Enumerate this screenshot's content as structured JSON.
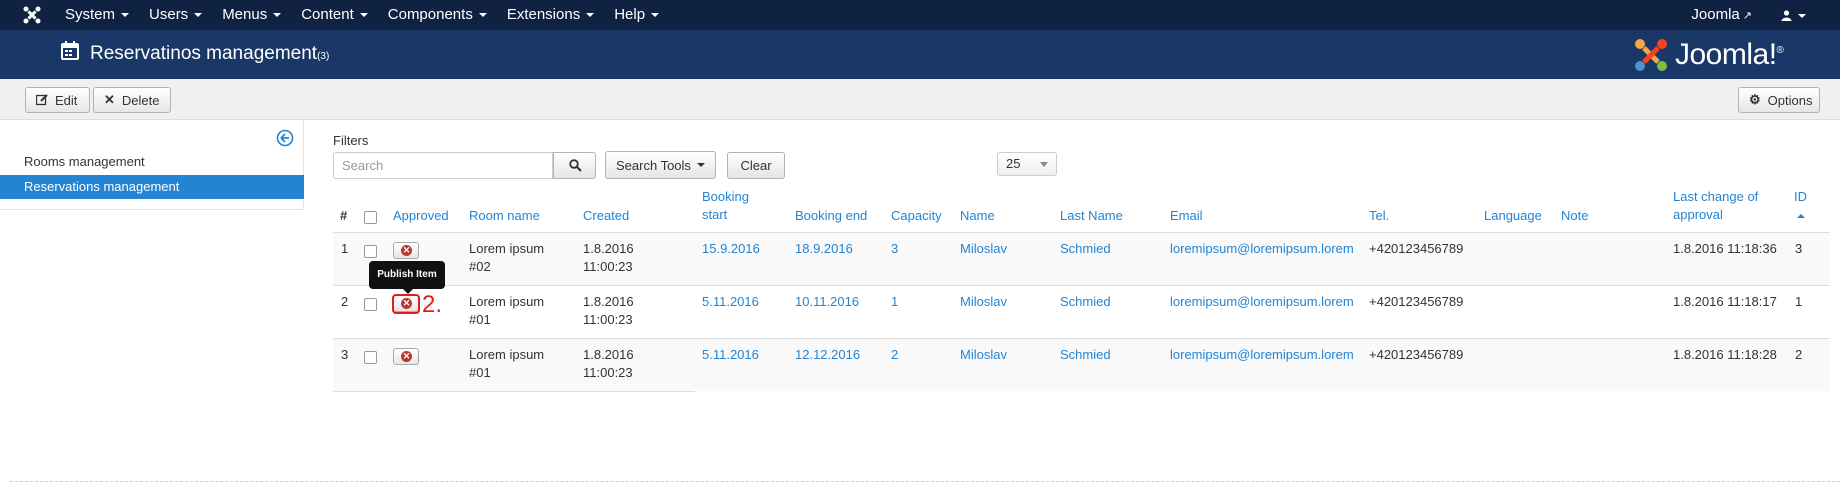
{
  "topnav": {
    "menu": [
      {
        "label": "System"
      },
      {
        "label": "Users"
      },
      {
        "label": "Menus"
      },
      {
        "label": "Content"
      },
      {
        "label": "Components"
      },
      {
        "label": "Extensions"
      },
      {
        "label": "Help"
      }
    ],
    "site_link": "Joomla",
    "user_icon": "user-icon"
  },
  "header": {
    "title": "Reservatinos management",
    "count": "(3)",
    "brand": "Joomla!",
    "brand_reg": "®"
  },
  "toolbar": {
    "edit_label": "Edit",
    "delete_label": "Delete",
    "options_label": "Options"
  },
  "sidebar": {
    "items": [
      {
        "label": "Rooms management",
        "active": false
      },
      {
        "label": "Reservations management",
        "active": true
      }
    ]
  },
  "filters": {
    "label": "Filters",
    "search_placeholder": "Search",
    "search_tools_label": "Search Tools",
    "clear_label": "Clear",
    "limit": "25"
  },
  "table": {
    "headers": {
      "hash": "#",
      "approved": "Approved",
      "room_name": "Room name",
      "created": "Created",
      "booking_start_1": "Booking",
      "booking_start_2": "start",
      "booking_end": "Booking end",
      "capacity": "Capacity",
      "name": "Name",
      "last_name": "Last Name",
      "email": "Email",
      "tel": "Tel.",
      "language": "Language",
      "note": "Note",
      "last_change_1": "Last change of",
      "last_change_2": "approval",
      "id": "ID"
    },
    "rows": [
      {
        "num": "1",
        "room_1": "Lorem ipsum",
        "room_2": "#02",
        "created_1": "1.8.2016",
        "created_2": "11:00:23",
        "start": "15.9.2016",
        "end": "18.9.2016",
        "capacity": "3",
        "name": "Miloslav",
        "last_name": "Schmied",
        "email": "loremipsum@loremipsum.lorem",
        "tel": "+420123456789",
        "language": "",
        "note": "",
        "last_change": "1.8.2016 11:18:36",
        "id": "3"
      },
      {
        "num": "2",
        "room_1": "Lorem ipsum",
        "room_2": "#01",
        "created_1": "1.8.2016",
        "created_2": "11:00:23",
        "start": "5.11.2016",
        "end": "10.11.2016",
        "capacity": "1",
        "name": "Miloslav",
        "last_name": "Schmied",
        "email": "loremipsum@loremipsum.lorem",
        "tel": "+420123456789",
        "language": "",
        "note": "",
        "last_change": "1.8.2016 11:18:17",
        "id": "1"
      },
      {
        "num": "3",
        "room_1": "Lorem ipsum",
        "room_2": "#01",
        "created_1": "1.8.2016",
        "created_2": "11:00:23",
        "start": "5.11.2016",
        "end": "12.12.2016",
        "capacity": "2",
        "name": "Miloslav",
        "last_name": "Schmied",
        "email": "loremipsum@loremipsum.lorem",
        "tel": "+420123456789",
        "language": "",
        "note": "",
        "last_change": "1.8.2016 11:18:28",
        "id": "2"
      }
    ]
  },
  "tooltip": "Publish Item",
  "annotation": "2.",
  "colors": {
    "navbar": "#0f2242",
    "header": "#1a3867",
    "link": "#2384d3",
    "active_nav": "#2384d3",
    "annotation": "#e21c1c"
  }
}
